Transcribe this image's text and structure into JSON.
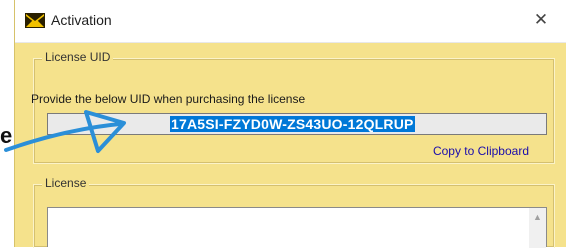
{
  "window": {
    "title": "Activation",
    "close_glyph": "✕",
    "app_icon": "envelope-logo-icon"
  },
  "uid_group": {
    "legend": "License UID",
    "instruction": "Provide the below UID when purchasing the license",
    "uid_value": "17A5SI-FZYD0W-ZS43UO-12QLRUP",
    "copy_label": "Copy to Clipboard"
  },
  "license_group": {
    "legend": "License",
    "value": ""
  },
  "annotation": {
    "label_fragment": "e",
    "arrow_color": "#2b8fd8",
    "arrow_icon": "pointer-arrow-icon"
  },
  "colors": {
    "dialog_background": "#f5e28c",
    "selection": "#0078d7",
    "link": "#1a0dab"
  }
}
